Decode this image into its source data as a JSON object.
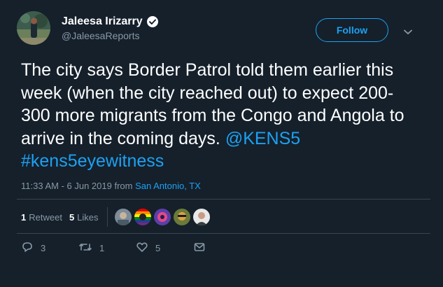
{
  "colors": {
    "background": "#15202b",
    "accent": "#1da1f2",
    "muted": "#8899a6",
    "divider": "#38444d"
  },
  "author": {
    "name": "Jaleesa Irizarry",
    "handle": "@JaleesaReports",
    "verified_icon": "verified-badge-icon"
  },
  "header": {
    "follow_label": "Follow",
    "menu_icon": "chevron-down-icon"
  },
  "tweet": {
    "text": "The city says Border Patrol told them earlier this week (when the city reached out) to expect 200-300 more migrants from the Congo and Angola to arrive in the coming days.",
    "mention": "@KENS5",
    "hashtag": "#kens5eyewitness"
  },
  "meta": {
    "timestamp": "11:33 AM - 6 Jun 2019",
    "from_label": "from",
    "location": "San Antonio, TX"
  },
  "stats": {
    "retweets_count": "1",
    "retweets_label": "Retweet",
    "likes_count": "5",
    "likes_label": "Likes"
  },
  "actions": {
    "reply_count": "3",
    "reply_icon": "reply-icon",
    "retweet_count": "1",
    "retweet_icon": "retweet-icon",
    "like_count": "5",
    "like_icon": "heart-icon",
    "dm_icon": "envelope-icon"
  }
}
